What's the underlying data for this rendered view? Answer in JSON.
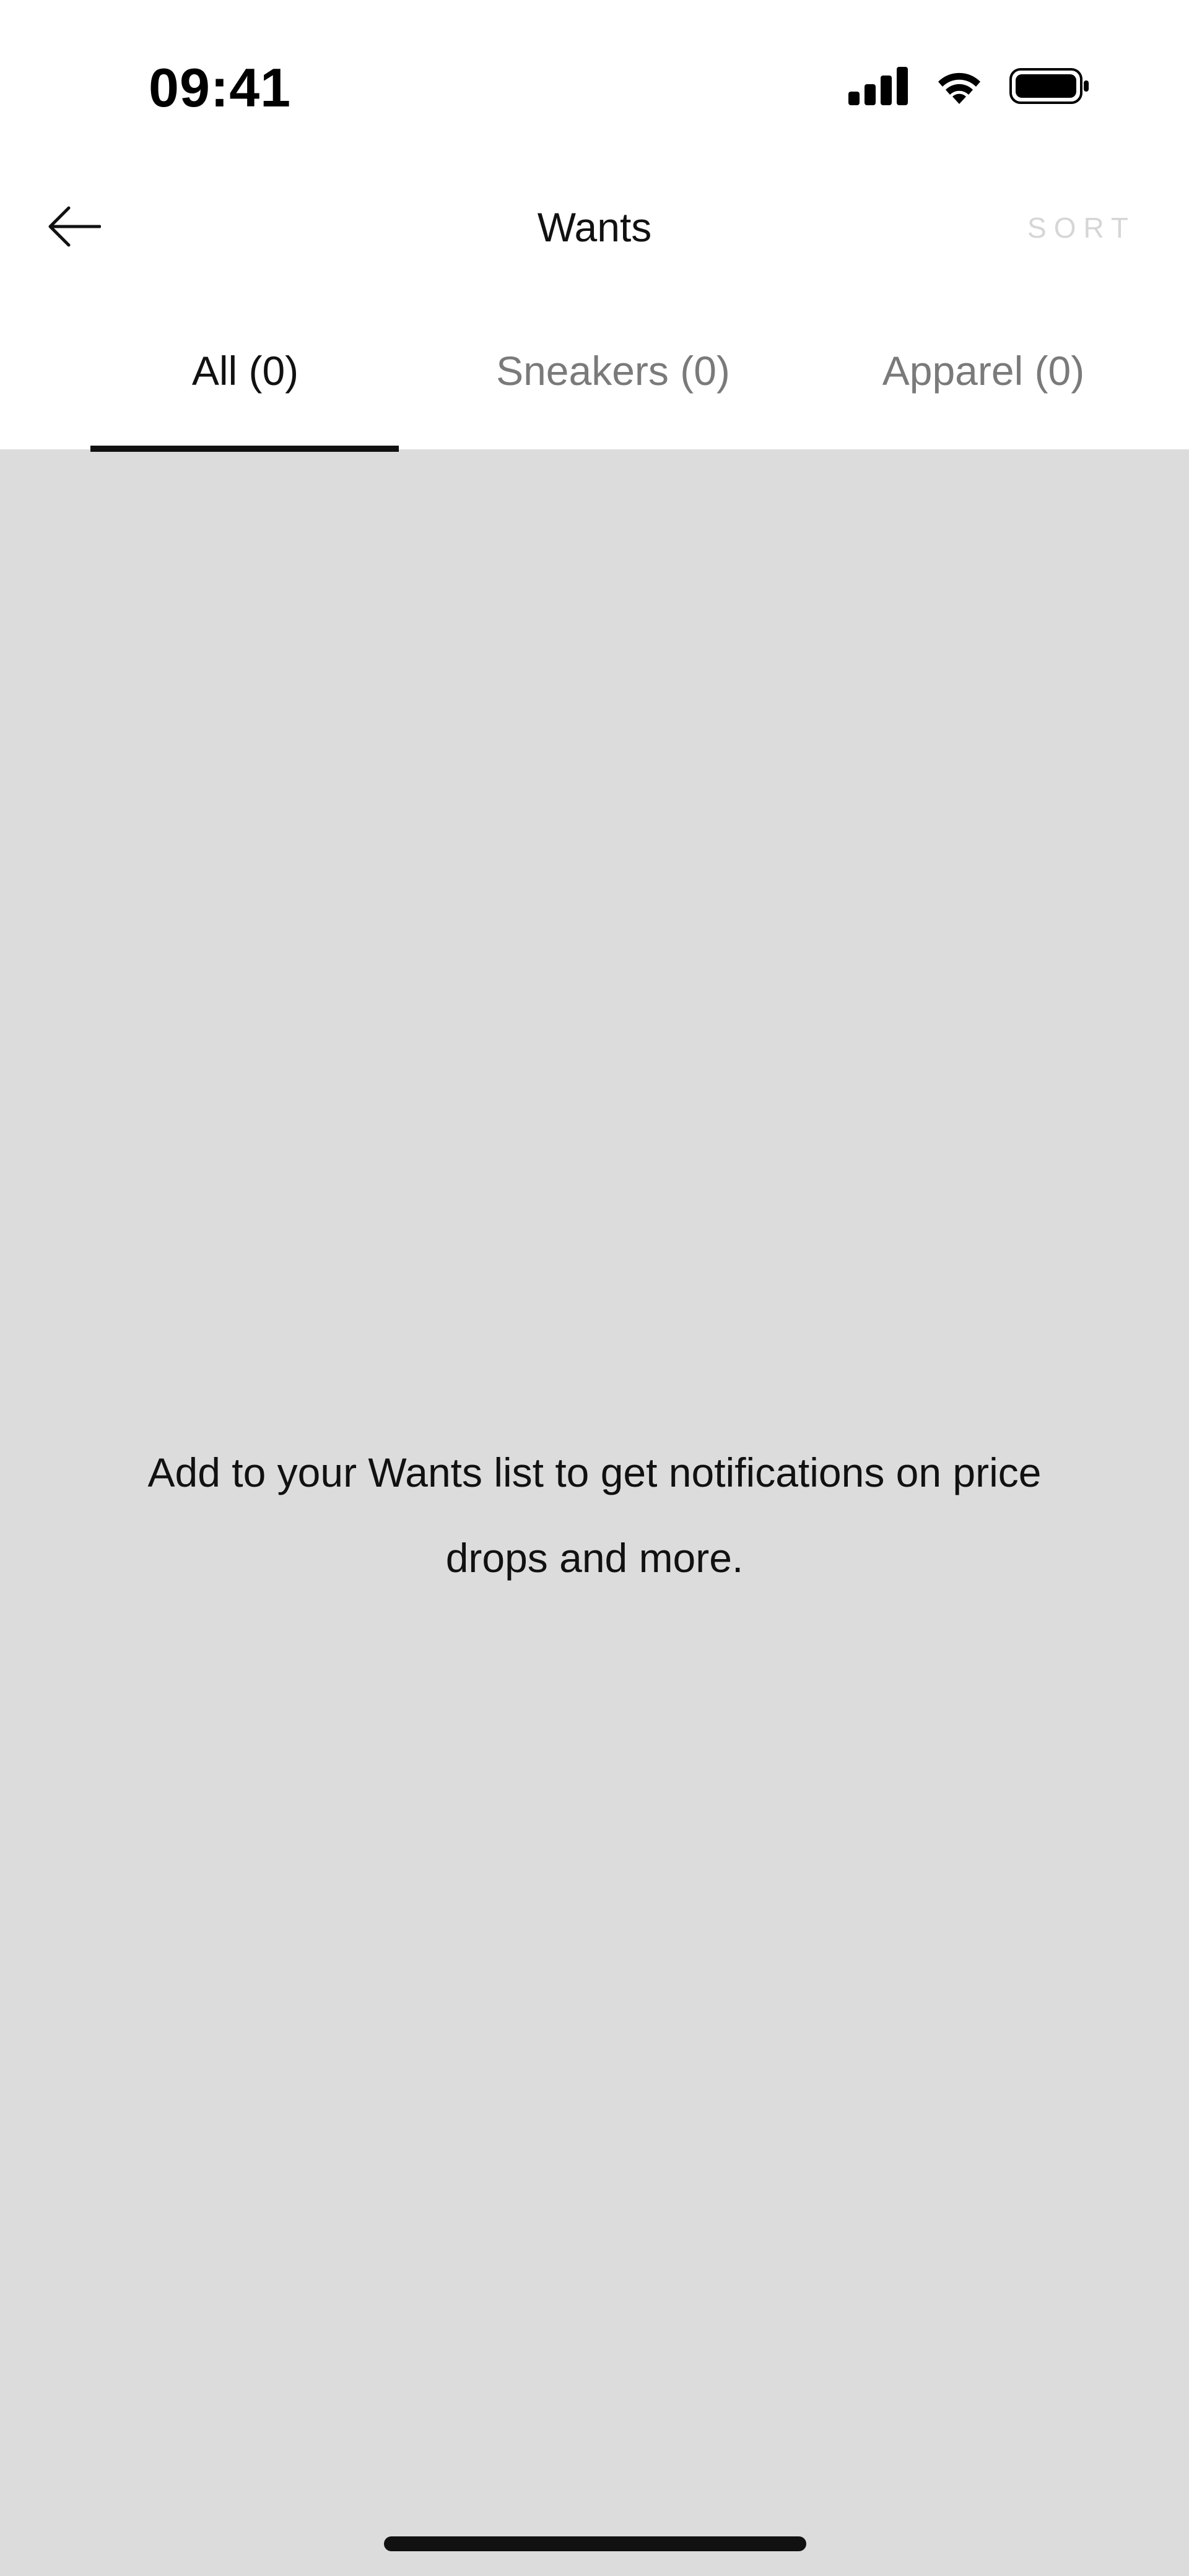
{
  "status_bar": {
    "time": "09:41",
    "icons": [
      "cellular-signal-icon",
      "wifi-icon",
      "battery-icon"
    ]
  },
  "header": {
    "back_icon": "arrow-left-icon",
    "title": "Wants",
    "sort_label": "SORT"
  },
  "tabs": [
    {
      "label": "All (0)",
      "active": true
    },
    {
      "label": "Sneakers (0)",
      "active": false
    },
    {
      "label": "Apparel (0)",
      "active": false
    }
  ],
  "empty_state": {
    "message": "Add to your Wants list to get notifications on price drops and more."
  },
  "colors": {
    "content_background": "#dcdcdc",
    "header_background": "#ffffff",
    "text_primary": "#111111",
    "tab_inactive": "#7a7a7a",
    "sort_disabled": "#d6d6d6"
  }
}
